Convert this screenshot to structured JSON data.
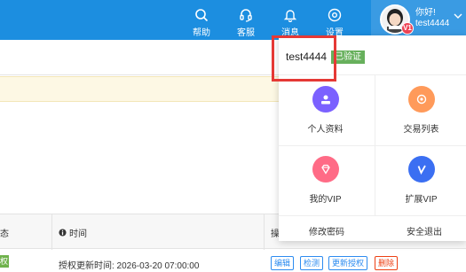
{
  "topbar": {
    "items": [
      {
        "label": "帮助",
        "icon": "search-icon"
      },
      {
        "label": "客服",
        "icon": "headset-icon"
      },
      {
        "label": "消息",
        "icon": "bell-icon"
      },
      {
        "label": "设置",
        "icon": "gear-icon"
      }
    ],
    "user": {
      "greeting": "你好!",
      "name": "test4444",
      "avatar_badge": "V1"
    },
    "color": "#1c8ee0"
  },
  "dropdown": {
    "username": "test4444",
    "verified_label": "已验证",
    "tiles": [
      {
        "label": "个人资料",
        "icon": "profile-icon",
        "color": "#7b61ff"
      },
      {
        "label": "交易列表",
        "icon": "transactions-icon",
        "color": "#ff9a5a"
      },
      {
        "label": "我的VIP",
        "icon": "diamond-icon",
        "color": "#ff6b86"
      },
      {
        "label": "扩展VIP",
        "icon": "vip-extend-icon",
        "color": "#3b6ff2"
      }
    ],
    "footer": {
      "change_password": "修改密码",
      "logout": "安全退出"
    }
  },
  "table": {
    "headers": {
      "status": "态",
      "time": "时间",
      "op": "操"
    },
    "row": {
      "status": "权",
      "auth_time": "授权更新时间:  2026-03-20 07:00:00",
      "buttons": {
        "edit": "编辑",
        "check": "检测",
        "renew": "更新授权",
        "delete": "删除"
      }
    }
  }
}
